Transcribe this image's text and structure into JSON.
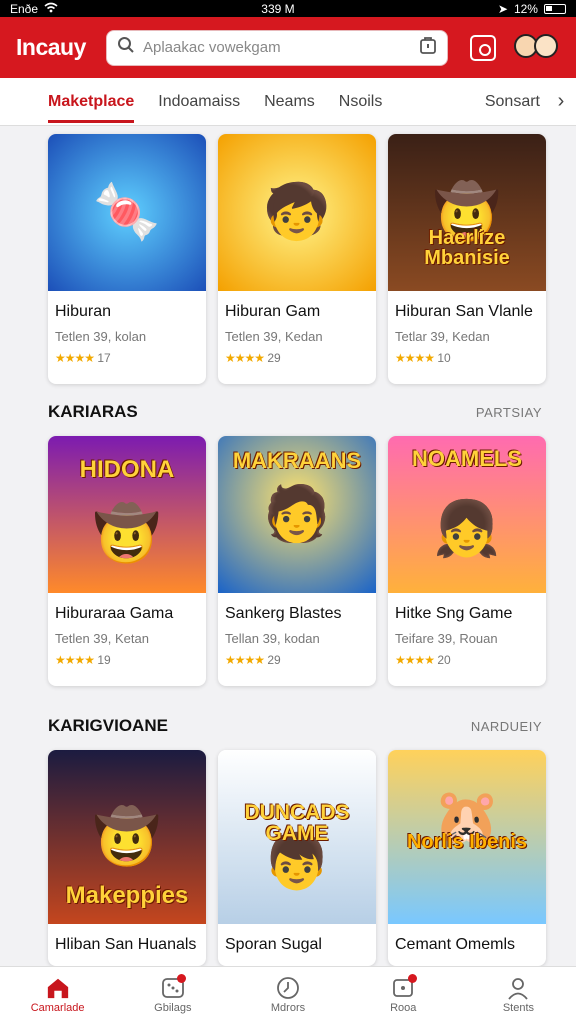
{
  "status": {
    "left": "Enðe",
    "time": "339 M",
    "battery": "12%"
  },
  "header": {
    "brand": "Incauy",
    "search_placeholder": "Aplaakac vowekgam"
  },
  "tabs": [
    {
      "label": "Maketplace"
    },
    {
      "label": "Indoamaiss"
    },
    {
      "label": "Neams"
    },
    {
      "label": "Nsoils"
    },
    {
      "label": "Sonsart"
    }
  ],
  "sections": [
    {
      "title": "",
      "more": ""
    },
    {
      "title": "KARIARAS",
      "more": "PARTSIAY"
    },
    {
      "title": "KARIGVIOANE",
      "more": "NARDUEIY"
    }
  ],
  "cards": [
    [
      {
        "title": "Hiburan",
        "sub": "Tetlen 39, kolan",
        "stars": "★★★★",
        "count": "17",
        "art": "🍬",
        "overlay": ""
      },
      {
        "title": "Hiburan Gam",
        "sub": "Tetlen 39, Kedan",
        "stars": "★★★★",
        "count": "29",
        "art": "🧒",
        "overlay": ""
      },
      {
        "title": "Hiburan San Vlanle",
        "sub": "Tetlar 39, Kedan",
        "stars": "★★★★",
        "count": "10",
        "art": "🤠",
        "overlay": "Haerlize Mbanisie"
      }
    ],
    [
      {
        "title": "Hiburaraa Gama",
        "sub": "Tetlen 39, Ketan",
        "stars": "★★★★",
        "count": "19",
        "art": "🤠",
        "overlay": "HIDONA"
      },
      {
        "title": "Sankerg Blastes",
        "sub": "Tellan 39, kodan",
        "stars": "★★★★",
        "count": "29",
        "art": "🧑",
        "overlay": "MAKRAANS"
      },
      {
        "title": "Hitke Sng Game",
        "sub": "Teifare 39, Rouan",
        "stars": "★★★★",
        "count": "20",
        "art": "👧",
        "overlay": "NOAMELS"
      }
    ],
    [
      {
        "title": "Hliban San Huanals",
        "sub": "",
        "stars": "",
        "count": "",
        "art": "🤠",
        "overlay": "Makeppies"
      },
      {
        "title": "Sporan Sugal",
        "sub": "",
        "stars": "",
        "count": "",
        "art": "👦",
        "overlay": "DUNCADS GAME"
      },
      {
        "title": "Cemant Omemls",
        "sub": "",
        "stars": "",
        "count": "",
        "art": "🐹",
        "overlay": "Norlis Ibenis"
      }
    ]
  ],
  "nav": [
    {
      "label": "Camarlade",
      "icon": "home-icon"
    },
    {
      "label": "Gbilags",
      "icon": "dice-icon"
    },
    {
      "label": "Mdrors",
      "icon": "clock-icon"
    },
    {
      "label": "Rooa",
      "icon": "card-icon"
    },
    {
      "label": "Stents",
      "icon": "person-icon"
    }
  ],
  "colors": {
    "accent": "#d6181f",
    "active_tab": "#c8161d",
    "star": "#f2a900"
  }
}
